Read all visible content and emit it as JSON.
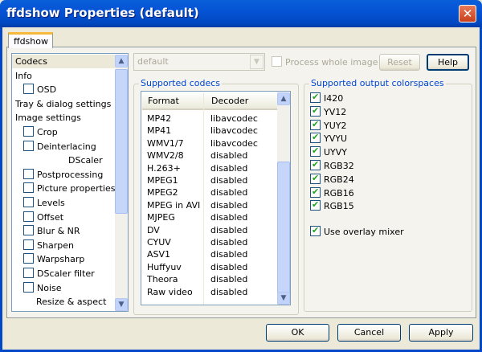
{
  "window": {
    "title": "ffdshow Properties (default)",
    "close_glyph": "✕"
  },
  "tabs": [
    {
      "label": "ffdshow"
    }
  ],
  "tree": {
    "items": [
      {
        "label": "Codecs",
        "indent": 0,
        "checkbox": false,
        "selected": true
      },
      {
        "label": "Info",
        "indent": 0,
        "checkbox": false
      },
      {
        "label": "OSD",
        "indent": 1,
        "checkbox": true,
        "checked": false
      },
      {
        "label": "Tray & dialog settings",
        "indent": 0,
        "checkbox": false
      },
      {
        "label": "Image settings",
        "indent": 0,
        "checkbox": false
      },
      {
        "label": "Crop",
        "indent": 1,
        "checkbox": true,
        "checked": false
      },
      {
        "label": "Deinterlacing",
        "indent": 1,
        "checkbox": true,
        "checked": false
      },
      {
        "label": "DScaler",
        "indent": 3,
        "checkbox": false
      },
      {
        "label": "Postprocessing",
        "indent": 1,
        "checkbox": true,
        "checked": false
      },
      {
        "label": "Picture properties",
        "indent": 1,
        "checkbox": true,
        "checked": false
      },
      {
        "label": "Levels",
        "indent": 1,
        "checkbox": true,
        "checked": false
      },
      {
        "label": "Offset",
        "indent": 1,
        "checkbox": true,
        "checked": false
      },
      {
        "label": "Blur & NR",
        "indent": 1,
        "checkbox": true,
        "checked": false
      },
      {
        "label": "Sharpen",
        "indent": 1,
        "checkbox": true,
        "checked": false
      },
      {
        "label": "Warpsharp",
        "indent": 1,
        "checkbox": true,
        "checked": false
      },
      {
        "label": "DScaler filter",
        "indent": 1,
        "checkbox": true,
        "checked": false
      },
      {
        "label": "Noise",
        "indent": 1,
        "checkbox": true,
        "checked": false
      },
      {
        "label": "Resize & aspect",
        "indent": 2,
        "checkbox": false
      }
    ]
  },
  "toolbar": {
    "preset": "default",
    "process_whole_image": "Process whole image",
    "reset": "Reset",
    "help": "Help"
  },
  "codecs": {
    "title": "Supported codecs",
    "headers": [
      "Format",
      "Decoder"
    ],
    "rows": [
      [
        "MP42",
        "libavcodec"
      ],
      [
        "MP41",
        "libavcodec"
      ],
      [
        "WMV1/7",
        "libavcodec"
      ],
      [
        "WMV2/8",
        "disabled"
      ],
      [
        "H.263+",
        "disabled"
      ],
      [
        "MPEG1",
        "disabled"
      ],
      [
        "MPEG2",
        "disabled"
      ],
      [
        "MPEG in AVI",
        "disabled"
      ],
      [
        "MJPEG",
        "disabled"
      ],
      [
        "DV",
        "disabled"
      ],
      [
        "CYUV",
        "disabled"
      ],
      [
        "ASV1",
        "disabled"
      ],
      [
        "Huffyuv",
        "disabled"
      ],
      [
        "Theora",
        "disabled"
      ],
      [
        "Raw video",
        "disabled"
      ]
    ]
  },
  "colorspaces": {
    "title": "Supported output colorspaces",
    "items": [
      {
        "label": "I420",
        "checked": true
      },
      {
        "label": "YV12",
        "checked": true
      },
      {
        "label": "YUY2",
        "checked": true
      },
      {
        "label": "YVYU",
        "checked": true
      },
      {
        "label": "UYVY",
        "checked": true
      },
      {
        "label": "RGB32",
        "checked": true
      },
      {
        "label": "RGB24",
        "checked": true
      },
      {
        "label": "RGB16",
        "checked": true
      },
      {
        "label": "RGB15",
        "checked": true
      }
    ],
    "overlay": {
      "label": "Use overlay mixer",
      "checked": true
    }
  },
  "buttons": {
    "ok": "OK",
    "cancel": "Cancel",
    "apply": "Apply"
  }
}
